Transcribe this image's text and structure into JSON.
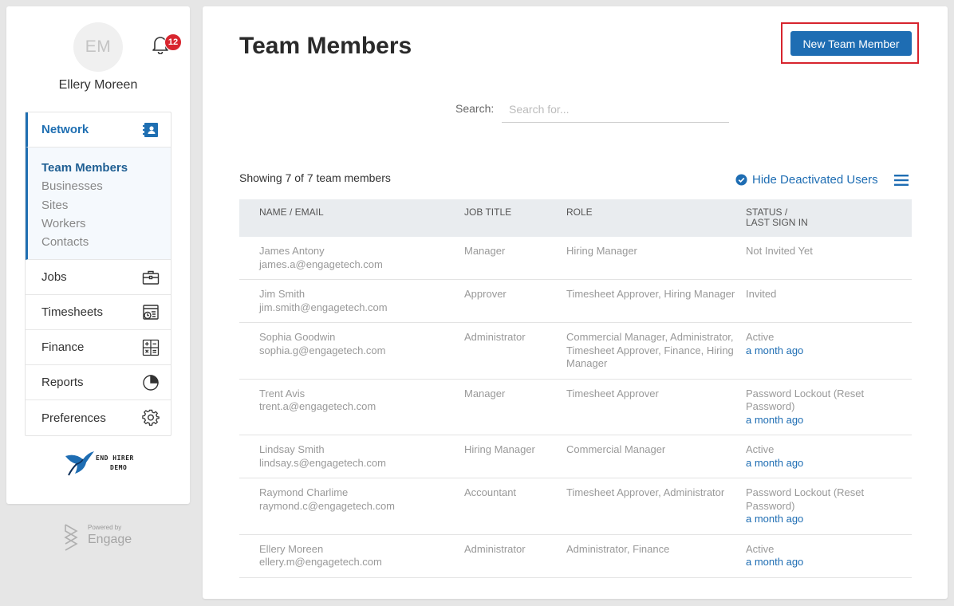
{
  "user": {
    "initials": "EM",
    "name": "Ellery Moreen",
    "notification_count": "12"
  },
  "nav": {
    "section": {
      "label": "Network",
      "icon": "contacts-book-icon"
    },
    "sub_items": [
      {
        "label": "Team Members",
        "active": true
      },
      {
        "label": "Businesses",
        "active": false
      },
      {
        "label": "Sites",
        "active": false
      },
      {
        "label": "Workers",
        "active": false
      },
      {
        "label": "Contacts",
        "active": false
      }
    ],
    "items": [
      {
        "label": "Jobs",
        "icon": "briefcase-icon"
      },
      {
        "label": "Timesheets",
        "icon": "timesheet-clock-icon"
      },
      {
        "label": "Finance",
        "icon": "calculator-icon"
      },
      {
        "label": "Reports",
        "icon": "pie-chart-icon"
      },
      {
        "label": "Preferences",
        "icon": "gear-icon"
      }
    ]
  },
  "branding": {
    "logo_line1": "END HIRER",
    "logo_line2": "DEMO",
    "powered_by": "Powered by",
    "powered_name": "Engage"
  },
  "page": {
    "title": "Team Members",
    "new_button": "New Team Member",
    "search_label": "Search:",
    "search_placeholder": "Search for...",
    "search_value": "",
    "showing": "Showing 7 of 7 team members",
    "hide_deactivated": "Hide Deactivated Users"
  },
  "table": {
    "headers": {
      "name_email": "NAME / EMAIL",
      "job_title": "JOB TITLE",
      "role": "ROLE",
      "status_line1": "STATUS /",
      "status_line2": "LAST SIGN IN"
    },
    "rows": [
      {
        "name": "James Antony",
        "email": "james.a@engagetech.com",
        "job_title": "Manager",
        "role": "Hiring Manager",
        "status": "Not Invited Yet",
        "last_sign_in": ""
      },
      {
        "name": "Jim Smith",
        "email": "jim.smith@engagetech.com",
        "job_title": "Approver",
        "role": "Timesheet Approver, Hiring Manager",
        "status": "Invited",
        "last_sign_in": ""
      },
      {
        "name": "Sophia Goodwin",
        "email": "sophia.g@engagetech.com",
        "job_title": "Administrator",
        "role": "Commercial Manager, Administrator, Timesheet Approver, Finance, Hiring Manager",
        "status": "Active",
        "last_sign_in": "a month ago"
      },
      {
        "name": "Trent Avis",
        "email": "trent.a@engagetech.com",
        "job_title": "Manager",
        "role": "Timesheet Approver",
        "status": "Password Lockout (Reset Password)",
        "last_sign_in": "a month ago"
      },
      {
        "name": "Lindsay Smith",
        "email": "lindsay.s@engagetech.com",
        "job_title": "Hiring Manager",
        "role": "Commercial Manager",
        "status": "Active",
        "last_sign_in": "a month ago"
      },
      {
        "name": "Raymond Charlime",
        "email": "raymond.c@engagetech.com",
        "job_title": "Accountant",
        "role": "Timesheet Approver, Administrator",
        "status": "Password Lockout (Reset Password)",
        "last_sign_in": "a month ago"
      },
      {
        "name": "Ellery Moreen",
        "email": "ellery.m@engagetech.com",
        "job_title": "Administrator",
        "role": "Administrator, Finance",
        "status": "Active",
        "last_sign_in": "a month ago"
      }
    ]
  },
  "colors": {
    "accent": "#1e6db3",
    "badge": "#d8252e",
    "highlight_frame": "#d7242e"
  }
}
